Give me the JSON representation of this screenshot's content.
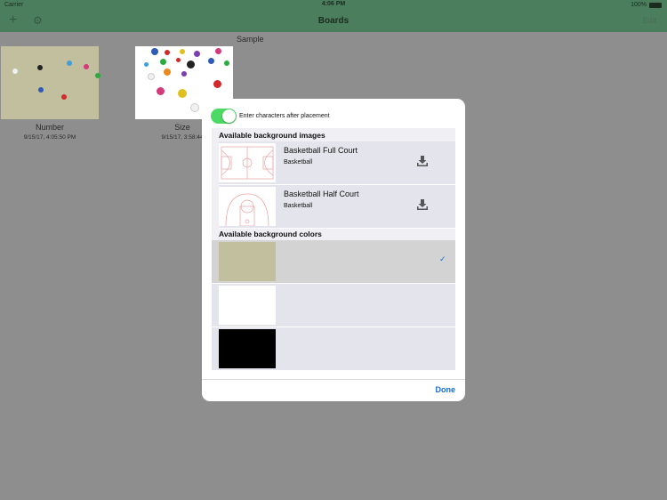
{
  "status_bar": {
    "carrier": "Carrier",
    "time": "4:06 PM",
    "battery": "100%"
  },
  "nav_bar": {
    "title": "Boards",
    "edit_label": "Edit",
    "add_icon": "plus-icon",
    "settings_icon": "gear-icon"
  },
  "section_title": "Sample",
  "boards": [
    {
      "name": "Number",
      "date": "9/15/17, 4:05:50 PM",
      "background": "#c1bf9e"
    },
    {
      "name": "Size",
      "date": "9/15/17, 3:58:44",
      "background": "#ffffff"
    }
  ],
  "dialog": {
    "toggle": {
      "label": "Enter characters after placement",
      "on": true
    },
    "images_header": "Available background images",
    "images": [
      {
        "title": "Basketball Full Court",
        "subtitle": "Basketball",
        "icon": "download-icon"
      },
      {
        "title": "Basketball Half Court",
        "subtitle": "Basketball",
        "icon": "download-icon"
      }
    ],
    "colors_header": "Available background colors",
    "colors": [
      {
        "color": "#c1bf9e",
        "selected": true
      },
      {
        "color": "#ffffff",
        "selected": false
      },
      {
        "color": "#000000",
        "selected": false
      }
    ],
    "check_icon": "checkmark-icon",
    "done_label": "Done"
  }
}
